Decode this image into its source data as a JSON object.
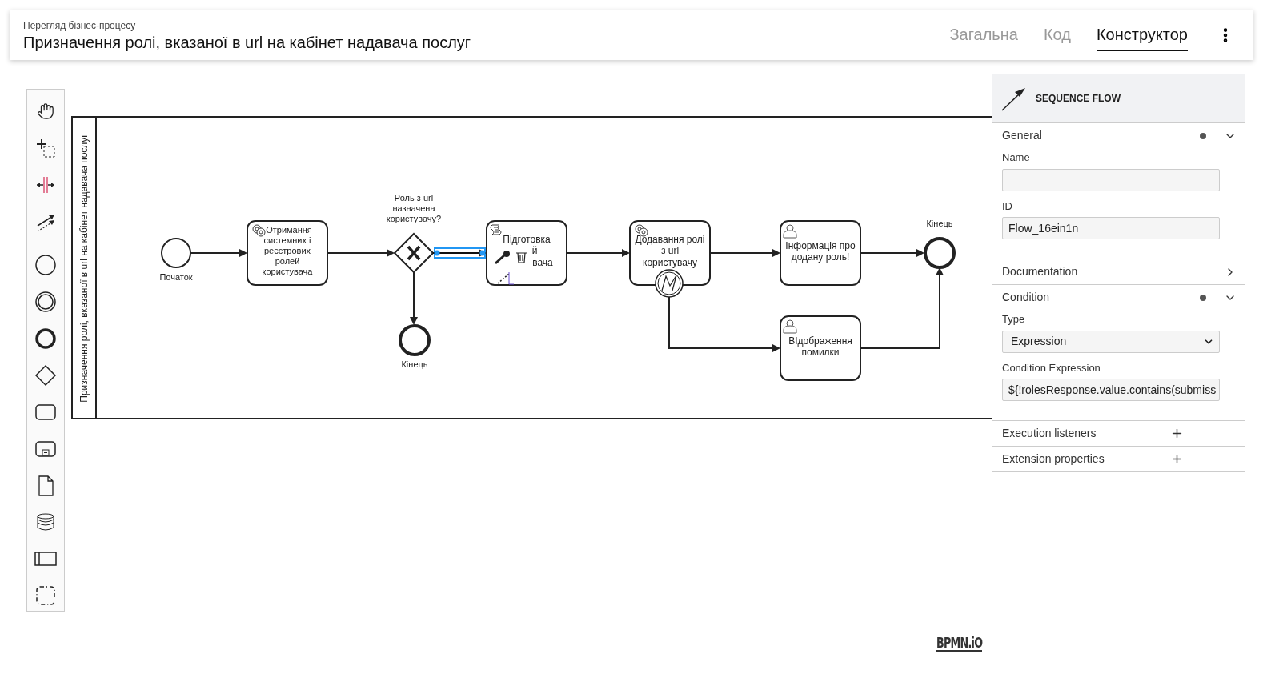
{
  "header": {
    "subtitle": "Перегляд бізнес-процесу",
    "title": "Призначення ролі, вказаної в url на кабінет надавача послуг",
    "tabs": [
      {
        "label": "Загальна",
        "selected": false
      },
      {
        "label": "Код",
        "selected": false
      },
      {
        "label": "Конструктор",
        "selected": true
      }
    ]
  },
  "diagram": {
    "pool_label": "Призначення ролі, вказаної в url на кабінет надавача послуг",
    "start_event": {
      "label": "Початок"
    },
    "gateway": {
      "lines": [
        "Роль з url",
        "назначена",
        "користувачу?"
      ]
    },
    "tasks": [
      {
        "kind": "service",
        "lines": [
          "Отримання",
          "системних і",
          "реєстрових",
          "ролей",
          "користувача"
        ]
      },
      {
        "kind": "script",
        "lines": [
          "Підготовка",
          "й",
          "вача"
        ]
      },
      {
        "kind": "service",
        "lines": [
          "Додавання ролі",
          "з url",
          "користувачу"
        ]
      },
      {
        "kind": "user",
        "lines": [
          "Інформація про",
          "додану роль!"
        ]
      },
      {
        "kind": "user",
        "lines": [
          "ВІдображення",
          "помилки"
        ]
      }
    ],
    "end_events": [
      {
        "label": "Кінець"
      },
      {
        "label": "Кінець"
      }
    ],
    "flows": [
      {
        "selected": false
      },
      {
        "selected": false
      },
      {
        "selected": true
      },
      {
        "selected": false
      },
      {
        "selected": false
      },
      {
        "selected": false
      },
      {
        "selected": false
      },
      {
        "selected": false
      },
      {
        "selected": false
      }
    ],
    "logo": "BPMN.iO"
  },
  "properties": {
    "element_type": "SEQUENCE FLOW",
    "groups": [
      {
        "title": "General",
        "kind": "section",
        "expanded": true,
        "dot": true,
        "fields": [
          {
            "label": "Name",
            "kind": "input"
          },
          {
            "label": "ID",
            "kind": "input",
            "value": "Flow_16ein1n"
          }
        ]
      },
      {
        "title": "Documentation",
        "kind": "section",
        "expanded": false,
        "dot": false
      },
      {
        "title": "Condition",
        "kind": "section",
        "expanded": true,
        "dot": true,
        "fields": [
          {
            "label": "Type",
            "kind": "select",
            "value": "Expression"
          },
          {
            "label": "Condition Expression",
            "kind": "input",
            "value": "${!rolesResponse.value.contains(submiss"
          }
        ]
      },
      {
        "title": "Execution listeners",
        "kind": "list"
      },
      {
        "title": "Extension properties",
        "kind": "list"
      }
    ]
  }
}
